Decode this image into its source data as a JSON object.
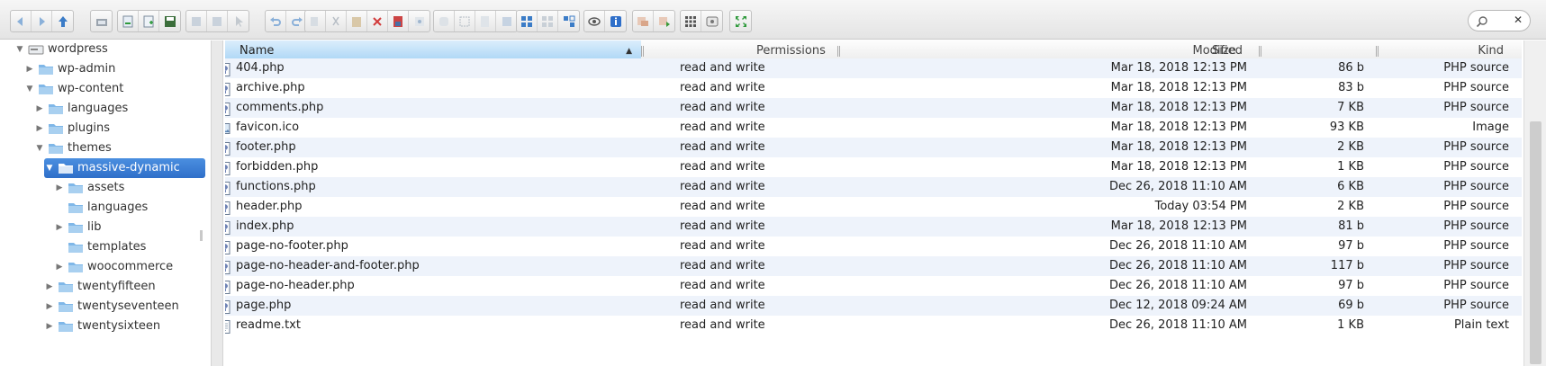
{
  "toolbar": {
    "groups": [
      {
        "buttons": [
          "back-icon",
          "forward-icon",
          "up-icon"
        ]
      },
      {
        "buttons": [
          "home-icon"
        ]
      },
      {
        "buttons": [
          "open-icon",
          "new-file-icon",
          "save-icon"
        ]
      },
      {
        "buttons": [
          "copy-path-icon",
          "disk-icon",
          "select-icon"
        ]
      },
      {
        "buttons": [
          "undo-icon",
          "redo-icon"
        ]
      },
      {
        "buttons": [
          "copy-icon",
          "cut-icon",
          "paste-icon",
          "delete-icon",
          "archive-icon",
          "extract-icon"
        ]
      },
      {
        "buttons": [
          "duplicate-icon",
          "rename-icon",
          "edit-icon",
          "resize-icon"
        ]
      },
      {
        "buttons": [
          "icons-view-icon",
          "list-view-icon",
          "columns-view-icon"
        ]
      },
      {
        "buttons": [
          "preview-icon",
          "info-icon"
        ]
      },
      {
        "buttons": [
          "upload-icon",
          "download-icon"
        ]
      },
      {
        "buttons": [
          "select-all-icon",
          "settings-icon"
        ]
      },
      {
        "buttons": [
          "fullscreen-icon"
        ]
      }
    ]
  },
  "search": {
    "clear_label": "✕"
  },
  "tree": {
    "items": [
      {
        "label": "wordpress",
        "depth": 0,
        "expanded": true,
        "selected": false,
        "kind": "drive"
      },
      {
        "label": "wp-admin",
        "depth": 1,
        "expanded": false,
        "selected": false,
        "kind": "folder"
      },
      {
        "label": "wp-content",
        "depth": 1,
        "expanded": true,
        "selected": false,
        "kind": "folder"
      },
      {
        "label": "languages",
        "depth": 2,
        "expanded": false,
        "selected": false,
        "kind": "folder"
      },
      {
        "label": "plugins",
        "depth": 2,
        "expanded": false,
        "selected": false,
        "kind": "folder"
      },
      {
        "label": "themes",
        "depth": 2,
        "expanded": true,
        "selected": false,
        "kind": "folder"
      },
      {
        "label": "massive-dynamic",
        "depth": 3,
        "expanded": true,
        "selected": true,
        "kind": "folder"
      },
      {
        "label": "assets",
        "depth": 4,
        "expanded": false,
        "selected": false,
        "kind": "folder"
      },
      {
        "label": "languages",
        "depth": 4,
        "expanded": null,
        "selected": false,
        "kind": "folder"
      },
      {
        "label": "lib",
        "depth": 4,
        "expanded": false,
        "selected": false,
        "kind": "folder"
      },
      {
        "label": "templates",
        "depth": 4,
        "expanded": null,
        "selected": false,
        "kind": "folder"
      },
      {
        "label": "woocommerce",
        "depth": 4,
        "expanded": false,
        "selected": false,
        "kind": "folder"
      },
      {
        "label": "twentyfifteen",
        "depth": 3,
        "expanded": false,
        "selected": false,
        "kind": "folder"
      },
      {
        "label": "twentyseventeen",
        "depth": 3,
        "expanded": false,
        "selected": false,
        "kind": "folder"
      },
      {
        "label": "twentysixteen",
        "depth": 3,
        "expanded": false,
        "selected": false,
        "kind": "folder"
      }
    ]
  },
  "list": {
    "columns": {
      "name": "Name",
      "permissions": "Permissions",
      "modified": "Modified",
      "size": "Size",
      "kind": "Kind"
    },
    "rows": [
      {
        "name": "404.php",
        "permissions": "read and write",
        "modified": "Mar 18, 2018 12:13 PM",
        "size": "86 b",
        "kind": "PHP source",
        "icon": "php-file-icon"
      },
      {
        "name": "archive.php",
        "permissions": "read and write",
        "modified": "Mar 18, 2018 12:13 PM",
        "size": "83 b",
        "kind": "PHP source",
        "icon": "php-file-icon"
      },
      {
        "name": "comments.php",
        "permissions": "read and write",
        "modified": "Mar 18, 2018 12:13 PM",
        "size": "7 KB",
        "kind": "PHP source",
        "icon": "php-file-icon"
      },
      {
        "name": "favicon.ico",
        "permissions": "read and write",
        "modified": "Mar 18, 2018 12:13 PM",
        "size": "93 KB",
        "kind": "Image",
        "icon": "image-file-icon"
      },
      {
        "name": "footer.php",
        "permissions": "read and write",
        "modified": "Mar 18, 2018 12:13 PM",
        "size": "2 KB",
        "kind": "PHP source",
        "icon": "php-file-icon"
      },
      {
        "name": "forbidden.php",
        "permissions": "read and write",
        "modified": "Mar 18, 2018 12:13 PM",
        "size": "1 KB",
        "kind": "PHP source",
        "icon": "php-file-icon"
      },
      {
        "name": "functions.php",
        "permissions": "read and write",
        "modified": "Dec 26, 2018 11:10 AM",
        "size": "6 KB",
        "kind": "PHP source",
        "icon": "php-file-icon"
      },
      {
        "name": "header.php",
        "permissions": "read and write",
        "modified": "Today 03:54 PM",
        "size": "2 KB",
        "kind": "PHP source",
        "icon": "php-file-icon"
      },
      {
        "name": "index.php",
        "permissions": "read and write",
        "modified": "Mar 18, 2018 12:13 PM",
        "size": "81 b",
        "kind": "PHP source",
        "icon": "php-file-icon"
      },
      {
        "name": "page-no-footer.php",
        "permissions": "read and write",
        "modified": "Dec 26, 2018 11:10 AM",
        "size": "97 b",
        "kind": "PHP source",
        "icon": "php-file-icon"
      },
      {
        "name": "page-no-header-and-footer.php",
        "permissions": "read and write",
        "modified": "Dec 26, 2018 11:10 AM",
        "size": "117 b",
        "kind": "PHP source",
        "icon": "php-file-icon"
      },
      {
        "name": "page-no-header.php",
        "permissions": "read and write",
        "modified": "Dec 26, 2018 11:10 AM",
        "size": "97 b",
        "kind": "PHP source",
        "icon": "php-file-icon"
      },
      {
        "name": "page.php",
        "permissions": "read and write",
        "modified": "Dec 12, 2018 09:24 AM",
        "size": "69 b",
        "kind": "PHP source",
        "icon": "php-file-icon"
      },
      {
        "name": "readme.txt",
        "permissions": "read and write",
        "modified": "Dec 26, 2018 11:10 AM",
        "size": "1 KB",
        "kind": "Plain text",
        "icon": "text-file-icon"
      }
    ]
  },
  "colors": {
    "selection": "#2f6fc9",
    "row_stripe": "#eef3fb",
    "header_active": "#a9d4f5",
    "folder": "#7fb7e8"
  }
}
